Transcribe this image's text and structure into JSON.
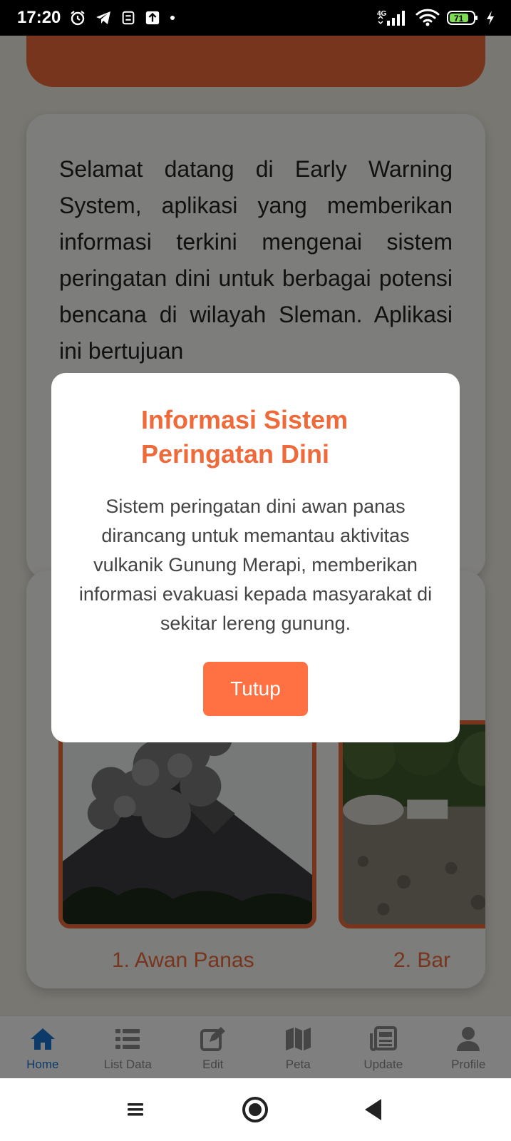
{
  "status_bar": {
    "time": "17:20",
    "network": "4G",
    "battery": "71",
    "icons": [
      "alarm-icon",
      "telegram-icon",
      "sync-icon",
      "upload-icon",
      "dot-icon",
      "signal-icon",
      "wifi-icon",
      "battery-icon",
      "charging-icon"
    ]
  },
  "welcome": {
    "text": "Selamat datang di Early Warning System, aplikasi yang memberikan informasi terkini mengenai sistem peringatan dini untuk berbagai potensi bencana di wilayah Sleman. Aplikasi ini bertujuan"
  },
  "gallery": {
    "items": [
      {
        "label": "1. Awan Panas"
      },
      {
        "label": "2. Bar"
      }
    ]
  },
  "modal": {
    "title": "Informasi Sistem Peringatan Dini",
    "body": "Sistem peringatan dini awan panas dirancang untuk memantau aktivitas vulkanik Gunung Merapi, memberikan informasi evakuasi kepada masyarakat di sekitar lereng gunung.",
    "button_label": "Tutup"
  },
  "bottom_nav": {
    "items": [
      {
        "label": "Home",
        "icon": "home-icon",
        "active": true
      },
      {
        "label": "List Data",
        "icon": "list-icon"
      },
      {
        "label": "Edit",
        "icon": "edit-icon"
      },
      {
        "label": "Peta",
        "icon": "map-icon"
      },
      {
        "label": "Update",
        "icon": "newspaper-icon"
      },
      {
        "label": "Profile",
        "icon": "person-icon"
      }
    ]
  },
  "colors": {
    "accent": "#ef6a3a",
    "button": "#ff7043",
    "active_nav": "#1976d2",
    "background": "#f3efe5"
  }
}
